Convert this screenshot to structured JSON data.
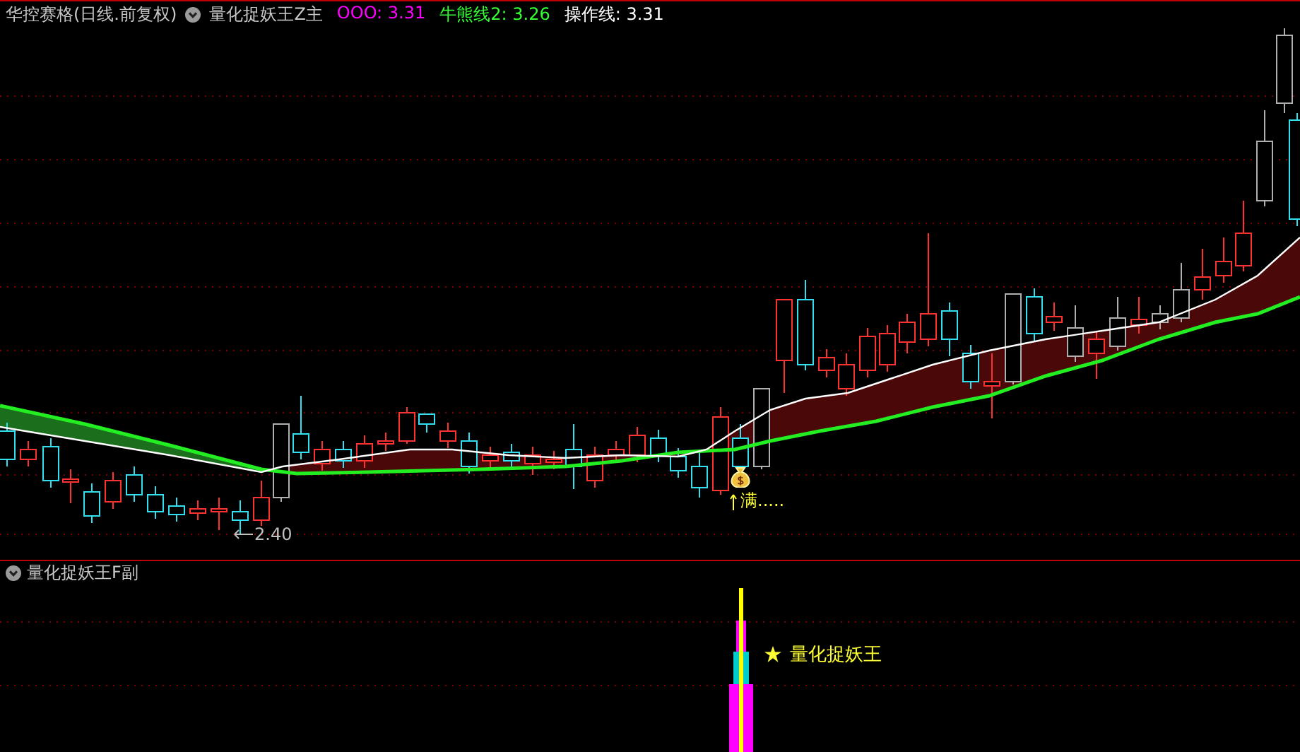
{
  "header": {
    "stock": "华控赛格(日线.前复权)",
    "indicator": "量化捉妖王Z主",
    "readings": [
      {
        "text": "OOO: 3.31",
        "color": "#ff00ff"
      },
      {
        "text": "牛熊线2: 3.26",
        "color": "#33ff33"
      },
      {
        "text": "操作线: 3.31",
        "color": "#ffffff"
      }
    ]
  },
  "main_chart": {
    "annotations": [
      {
        "kind": "low",
        "text": "2.40"
      },
      {
        "kind": "signal",
        "text": "满....."
      }
    ]
  },
  "sub_panel": {
    "title": "量化捉妖王F副",
    "signal": {
      "text": "量化捉妖王"
    }
  }
}
